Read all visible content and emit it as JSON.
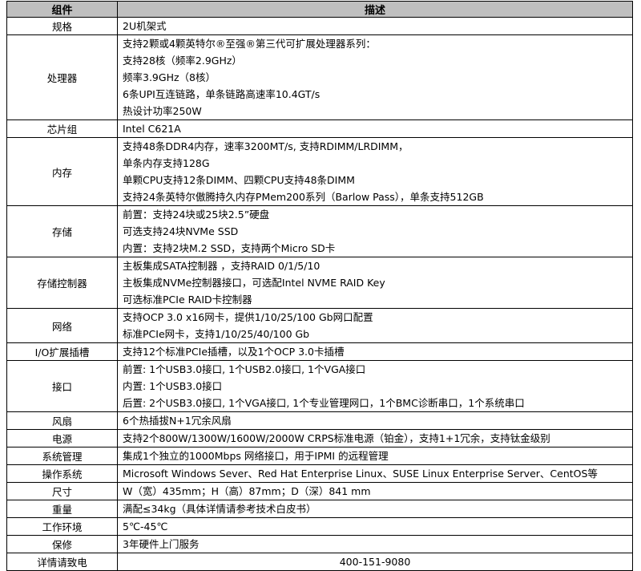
{
  "header": {
    "component": "组件",
    "description": "描述"
  },
  "rows": [
    {
      "name": "规格",
      "lines": [
        "2U机架式"
      ]
    },
    {
      "name": "处理器",
      "lines": [
        "支持2颗或4颗英特尔®至强®第三代可扩展处理器系列：",
        "支持28核（频率2.9GHz）",
        "频率3.9GHz（8核）",
        "6条UPI互连链路，单条链路高速率10.4GT/s",
        "热设计功率250W"
      ]
    },
    {
      "name": "芯片组",
      "lines": [
        "Intel C621A"
      ]
    },
    {
      "name": "内存",
      "lines": [
        "支持48条DDR4内存，速率3200MT/s, 支持RDIMM/LRDIMM，",
        "单条内存支持128G",
        "单颗CPU支持12条DIMM、四颗CPU支持48条DIMM",
        "支持24条英特尔傲腾持久内存PMem200系列（Barlow Pass），单条支持512GB"
      ]
    },
    {
      "name": "存储",
      "lines": [
        "前置：支持24块或25块2.5”硬盘",
        " 可选支持24块NVMe SSD",
        "内置：支持2块M.2 SSD，支持两个Micro SD卡"
      ]
    },
    {
      "name": "存储控制器",
      "lines": [
        "主板集成SATA控制器 ，支持RAID 0/1/5/10",
        "主板集成NVMe控制器接口，可选配Intel NVME RAID Key",
        "可选标准PCIe RAID卡控制器"
      ]
    },
    {
      "name": "网络",
      "lines": [
        "支持OCP 3.0 x16网卡，提供1/10/25/100 Gb网口配置",
        "标准PCIe网卡，支持1/10/25/40/100 Gb"
      ]
    },
    {
      "name": "I/O扩展插槽",
      "lines": [
        "支持12个标准PCIe插槽，以及1个OCP 3.0卡插槽"
      ]
    },
    {
      "name": "接口",
      "lines": [
        "前置: 1个USB3.0接口, 1个USB2.0接口, 1个VGA接口",
        "内置: 1个USB3.0接口",
        "后置: 2个USB3.0接口, 1个VGA接口, 1个专业管理网口，1个BMC诊断串口，1个系统串口"
      ]
    },
    {
      "name": "风扇",
      "lines": [
        "6个热插拔N+1冗余风扇"
      ]
    },
    {
      "name": "电源",
      "lines": [
        "支持2个800W/1300W/1600W/2000W CRPS标准电源（铂金），支持1+1冗余，支持钛金级别"
      ]
    },
    {
      "name": "系统管理",
      "lines": [
        "集成1个独立的1000Mbps 网络接口，用于IPMI 的远程管理"
      ]
    },
    {
      "name": "操作系统",
      "lines": [
        "Microsoft Windows Sever、Red Hat Enterprise Linux、SUSE Linux Enterprise Server、CentOS等"
      ]
    },
    {
      "name": "尺寸",
      "lines": [
        "W（宽）435mm；H（高）87mm；D（深）841 mm"
      ]
    },
    {
      "name": "重量",
      "lines": [
        "满配≤34kg（具体详情请参考技术白皮书）"
      ]
    },
    {
      "name": "工作环境",
      "lines": [
        "5℃-45℃"
      ]
    },
    {
      "name": "保修",
      "lines": [
        "3年硬件上门服务"
      ]
    }
  ],
  "contact": {
    "name": "详情请致电",
    "phone": "400-151-9080"
  }
}
